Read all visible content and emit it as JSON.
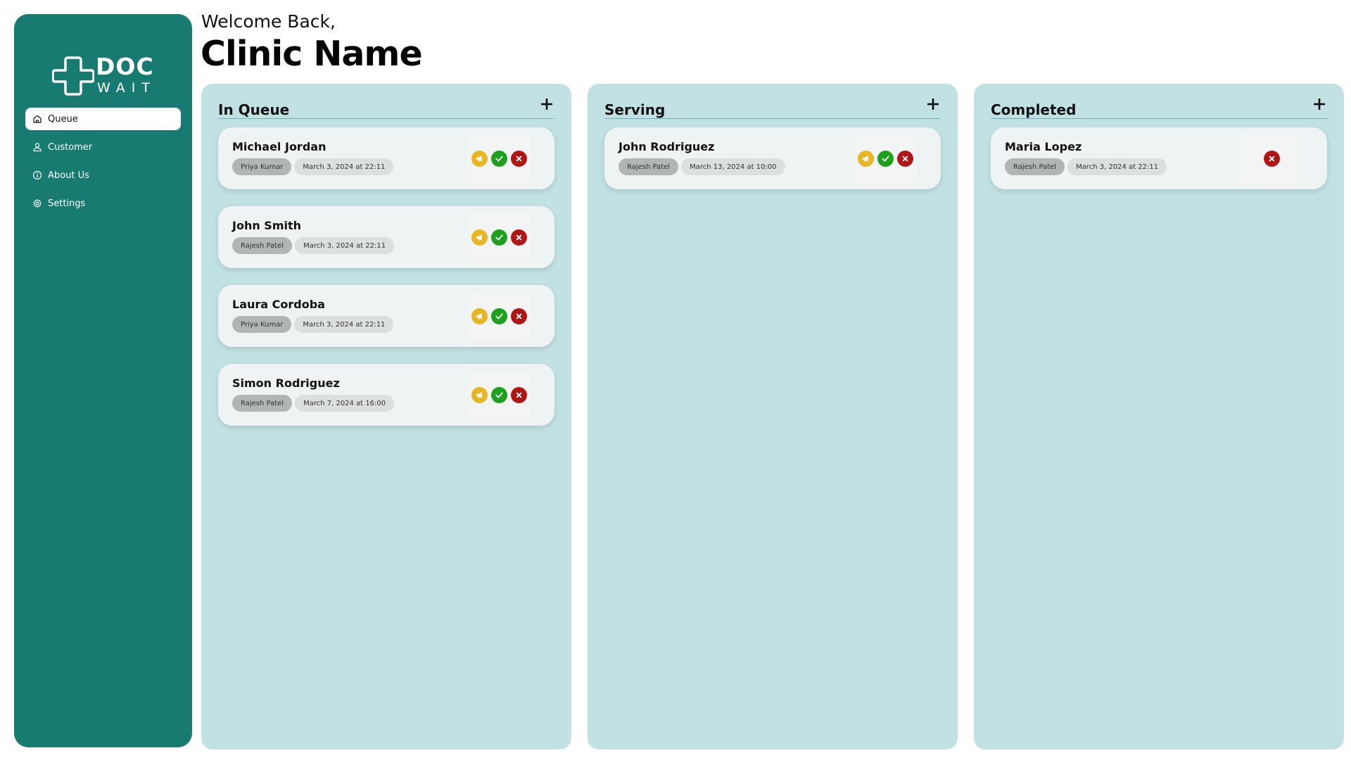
{
  "brand": {
    "line1": "DOC",
    "line2": "WAIT"
  },
  "nav": {
    "queue": "Queue",
    "customer": "Customer",
    "about": "About Us",
    "settings": "Settings"
  },
  "header": {
    "welcome": "Welcome Back,",
    "clinic": "Clinic Name"
  },
  "columns": {
    "queue": {
      "title": "In Queue",
      "cards": [
        {
          "name": "Michael Jordan",
          "staff": "Priya Kumar",
          "date": "March 3, 2024 at 22:11"
        },
        {
          "name": "John Smith",
          "staff": "Rajesh Patel",
          "date": "March 3, 2024 at 22:11"
        },
        {
          "name": "Laura Cordoba",
          "staff": "Priya Kumar",
          "date": "March 3, 2024 at 22:11"
        },
        {
          "name": "Simon Rodriguez",
          "staff": "Rajesh Patel",
          "date": "March 7, 2024 at 16:00"
        }
      ]
    },
    "serving": {
      "title": "Serving",
      "cards": [
        {
          "name": "John Rodriguez",
          "staff": "Rajesh Patel",
          "date": "March 13, 2024 at 10:00"
        }
      ]
    },
    "completed": {
      "title": "Completed",
      "cards": [
        {
          "name": "Maria Lopez",
          "staff": "Rajesh Patel",
          "date": "March 3, 2024 at 22:11"
        }
      ]
    }
  },
  "icons": {
    "call": "megaphone-icon",
    "done": "check-icon",
    "cancel": "close-icon",
    "add": "plus-icon"
  },
  "colors": {
    "sidebar": "#177b72",
    "column": "#c2e1e2",
    "call": "#e8b622",
    "done": "#1ca11c",
    "cancel": "#b01616"
  }
}
